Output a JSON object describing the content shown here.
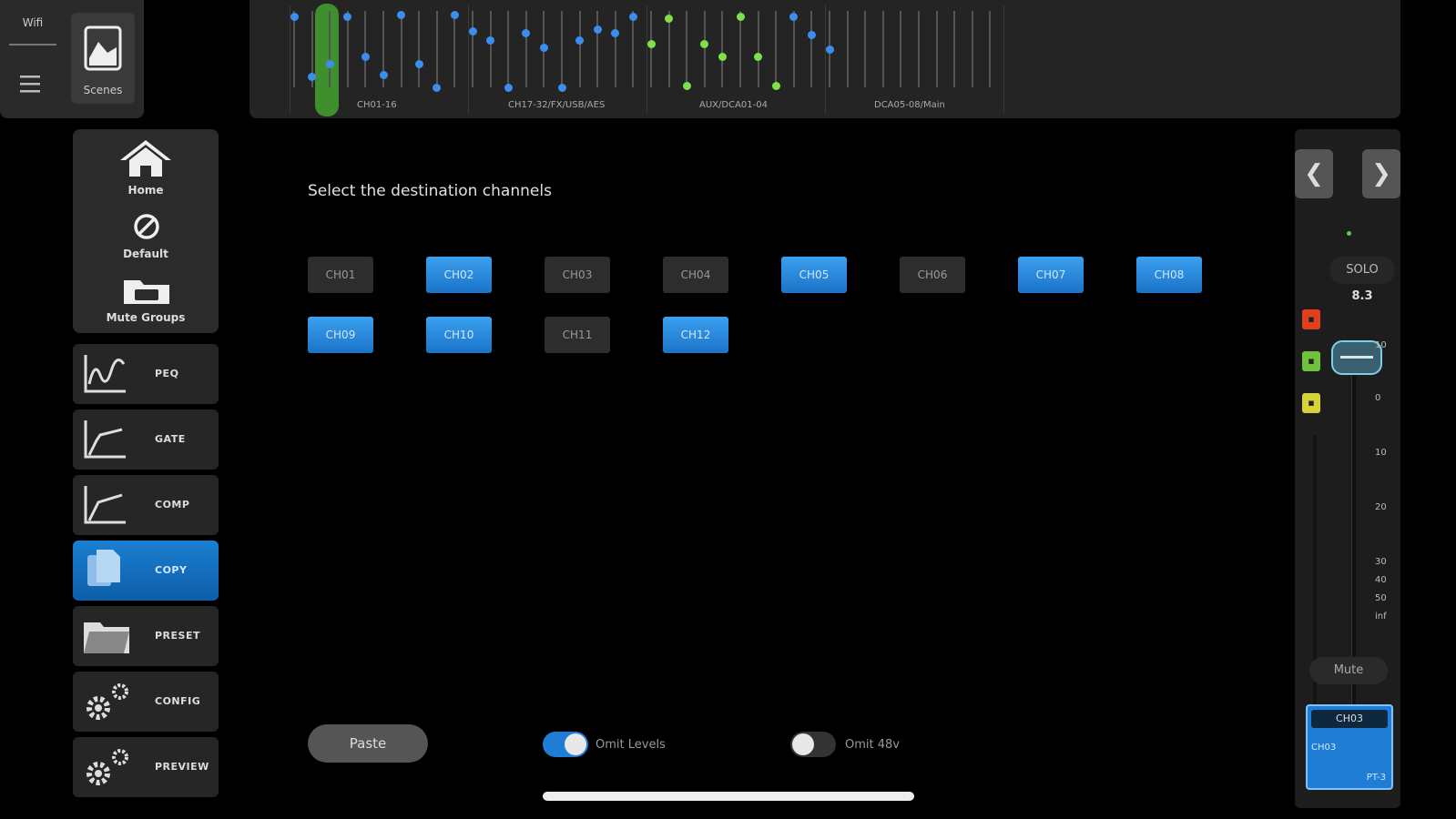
{
  "topleft": {
    "wifi_label": "Wifi",
    "scenes_label": "Scenes"
  },
  "nav": {
    "home": "Home",
    "default": "Default",
    "mute_groups": "Mute Groups"
  },
  "tools": [
    {
      "label": "PEQ",
      "icon": "peq-curve-icon",
      "active": false
    },
    {
      "label": "GATE",
      "icon": "gate-curve-icon",
      "active": false
    },
    {
      "label": "COMP",
      "icon": "comp-curve-icon",
      "active": false
    },
    {
      "label": "COPY",
      "icon": "copy-icon",
      "active": true
    },
    {
      "label": "PRESET",
      "icon": "preset-folder-icon",
      "active": false
    },
    {
      "label": "CONFIG",
      "icon": "gears-icon",
      "active": false
    },
    {
      "label": "PREVIEW",
      "icon": "gears-icon",
      "active": false
    }
  ],
  "strip": {
    "groups": [
      "CH01-16",
      "CH17-32/FX/USB/AES",
      "AUX/DCA01-04",
      "DCA05-08/Main"
    ]
  },
  "main": {
    "title": "Select the destination channels",
    "channels": [
      {
        "label": "CH01",
        "selected": false
      },
      {
        "label": "CH02",
        "selected": true
      },
      {
        "label": "CH03",
        "selected": false
      },
      {
        "label": "CH04",
        "selected": false
      },
      {
        "label": "CH05",
        "selected": true
      },
      {
        "label": "CH06",
        "selected": false
      },
      {
        "label": "CH07",
        "selected": true
      },
      {
        "label": "CH08",
        "selected": true
      },
      {
        "label": "CH09",
        "selected": true
      },
      {
        "label": "CH10",
        "selected": true
      },
      {
        "label": "CH11",
        "selected": false
      },
      {
        "label": "CH12",
        "selected": true
      }
    ],
    "paste_label": "Paste",
    "omit_levels": {
      "label": "Omit Levels",
      "on": true
    },
    "omit_48v": {
      "label": "Omit 48v",
      "on": false
    }
  },
  "right": {
    "prev": "❮",
    "next": "❯",
    "solo_label": "SOLO",
    "gain": "8.3",
    "scale": [
      "10",
      "0",
      "10",
      "20",
      "30",
      "40",
      "50",
      "inf"
    ],
    "mute_label": "Mute",
    "channel_card": {
      "title": "CH03",
      "name": "CH03",
      "pt": "PT-3"
    }
  },
  "colors": {
    "accent": "#1f7ed4",
    "active_nav": "#1b7fd1",
    "strip_highlight": "#3f8f2f",
    "dot_blue": "#3b8ef0",
    "dot_green": "#7ee04a"
  }
}
